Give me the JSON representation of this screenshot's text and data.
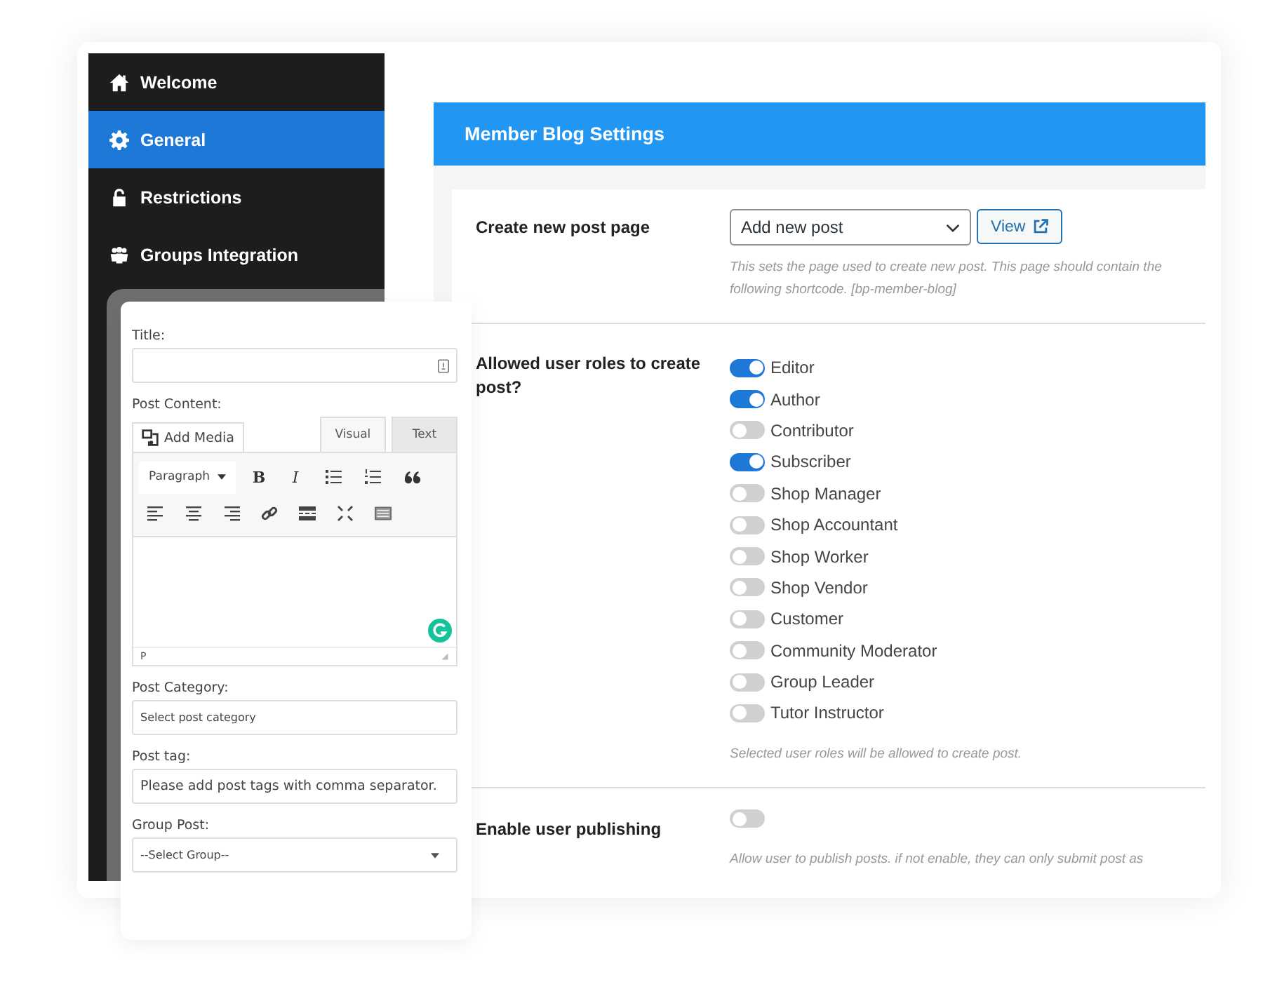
{
  "sidebar": {
    "items": [
      {
        "label": "Welcome",
        "selected": false
      },
      {
        "label": "General",
        "selected": true
      },
      {
        "label": "Restrictions",
        "selected": false
      },
      {
        "label": "Groups Integration",
        "selected": false
      }
    ]
  },
  "settings": {
    "title": "Member Blog Settings",
    "create_page": {
      "label": "Create new post page",
      "select_value": "Add new post",
      "view_button": "View",
      "help": "This sets the page used to create new post. This page should contain the following shortcode. [bp-member-blog]"
    },
    "roles": {
      "label": "Allowed user roles to create post?",
      "help": "Selected user roles will be allowed to create post.",
      "toggles": [
        {
          "label": "Editor",
          "on": true
        },
        {
          "label": "Author",
          "on": true
        },
        {
          "label": "Contributor",
          "on": false
        },
        {
          "label": "Subscriber",
          "on": true
        },
        {
          "label": "Shop Manager",
          "on": false
        },
        {
          "label": "Shop Accountant",
          "on": false
        },
        {
          "label": "Shop Worker",
          "on": false
        },
        {
          "label": "Shop Vendor",
          "on": false
        },
        {
          "label": "Customer",
          "on": false
        },
        {
          "label": "Community Moderator",
          "on": false
        },
        {
          "label": "Group Leader",
          "on": false
        },
        {
          "label": "Tutor Instructor",
          "on": false
        }
      ]
    },
    "publishing": {
      "label": "Enable user publishing",
      "on": false,
      "help": "Allow user to publish posts. if not enable, they can only submit post as"
    }
  },
  "post_form": {
    "title_label": "Title:",
    "content_label": "Post Content:",
    "add_media": "Add Media",
    "editor_tabs": [
      {
        "label": "Visual",
        "selected": true
      },
      {
        "label": "Text",
        "selected": false
      }
    ],
    "format": "Paragraph",
    "bold": "B",
    "italic": "I",
    "status_path": "P",
    "category_label": "Post Category:",
    "category_placeholder": "Select post category",
    "tag_label": "Post tag:",
    "tag_placeholder": "Please add post tags with comma separator.",
    "group_label": "Group Post:",
    "group_value": "--Select Group--"
  }
}
